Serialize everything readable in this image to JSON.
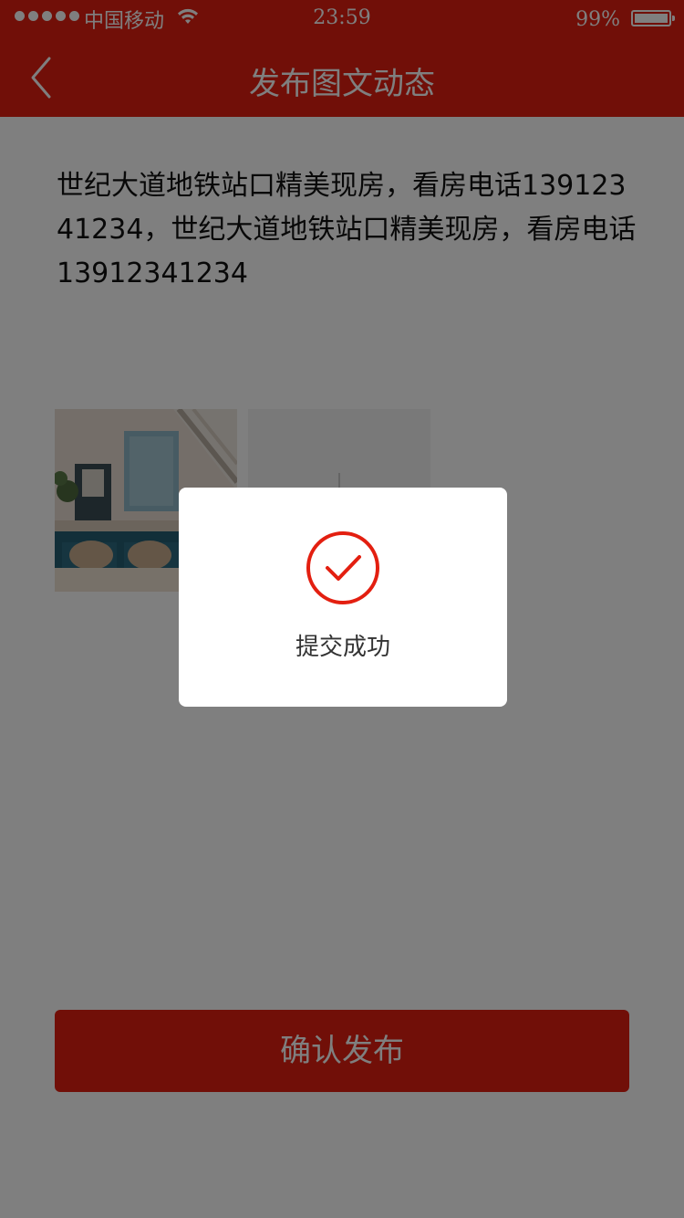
{
  "status_bar": {
    "carrier": "中国移动",
    "time": "23:59",
    "battery_percent": "99%",
    "battery_level": 0.99,
    "signal_dots": 5,
    "wifi_icon": "wifi-icon",
    "battery_icon": "battery-icon"
  },
  "nav": {
    "title": "发布图文动态",
    "back_icon": "chevron-left-icon"
  },
  "post": {
    "text": "世纪大道地铁站口精美现房，看房电话13912341234，世纪大道地铁站口精美现房，看房电话13912341234"
  },
  "photos": {
    "add_icon": "plus-icon"
  },
  "actions": {
    "confirm_label": "确认发布"
  },
  "toast": {
    "message": "提交成功",
    "icon": "check-circle-icon"
  },
  "colors": {
    "brand_red": "#e31f10",
    "mask": "rgba(0,0,0,0.5)"
  }
}
